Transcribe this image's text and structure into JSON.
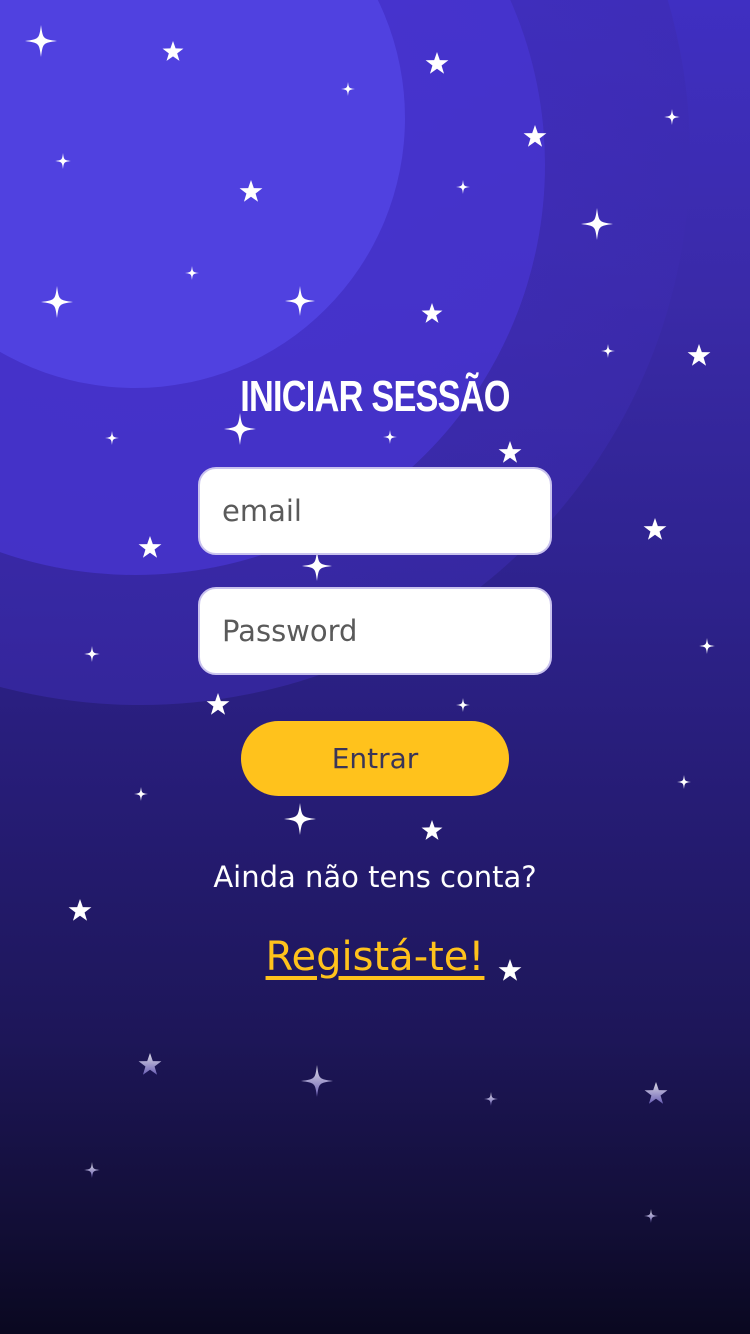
{
  "login": {
    "title": "INICIAR SESSÃO",
    "email_placeholder": "email",
    "password_placeholder": "Password",
    "submit_label": "Entrar",
    "no_account_text": "Ainda não tens conta?",
    "register_link": "Registá-te!"
  },
  "colors": {
    "accent": "#ffc21c",
    "background_top": "#4b3ad8",
    "background_bottom": "#0a0820",
    "title": "#ffffff"
  },
  "icons": {
    "decoration": "star-icon"
  }
}
